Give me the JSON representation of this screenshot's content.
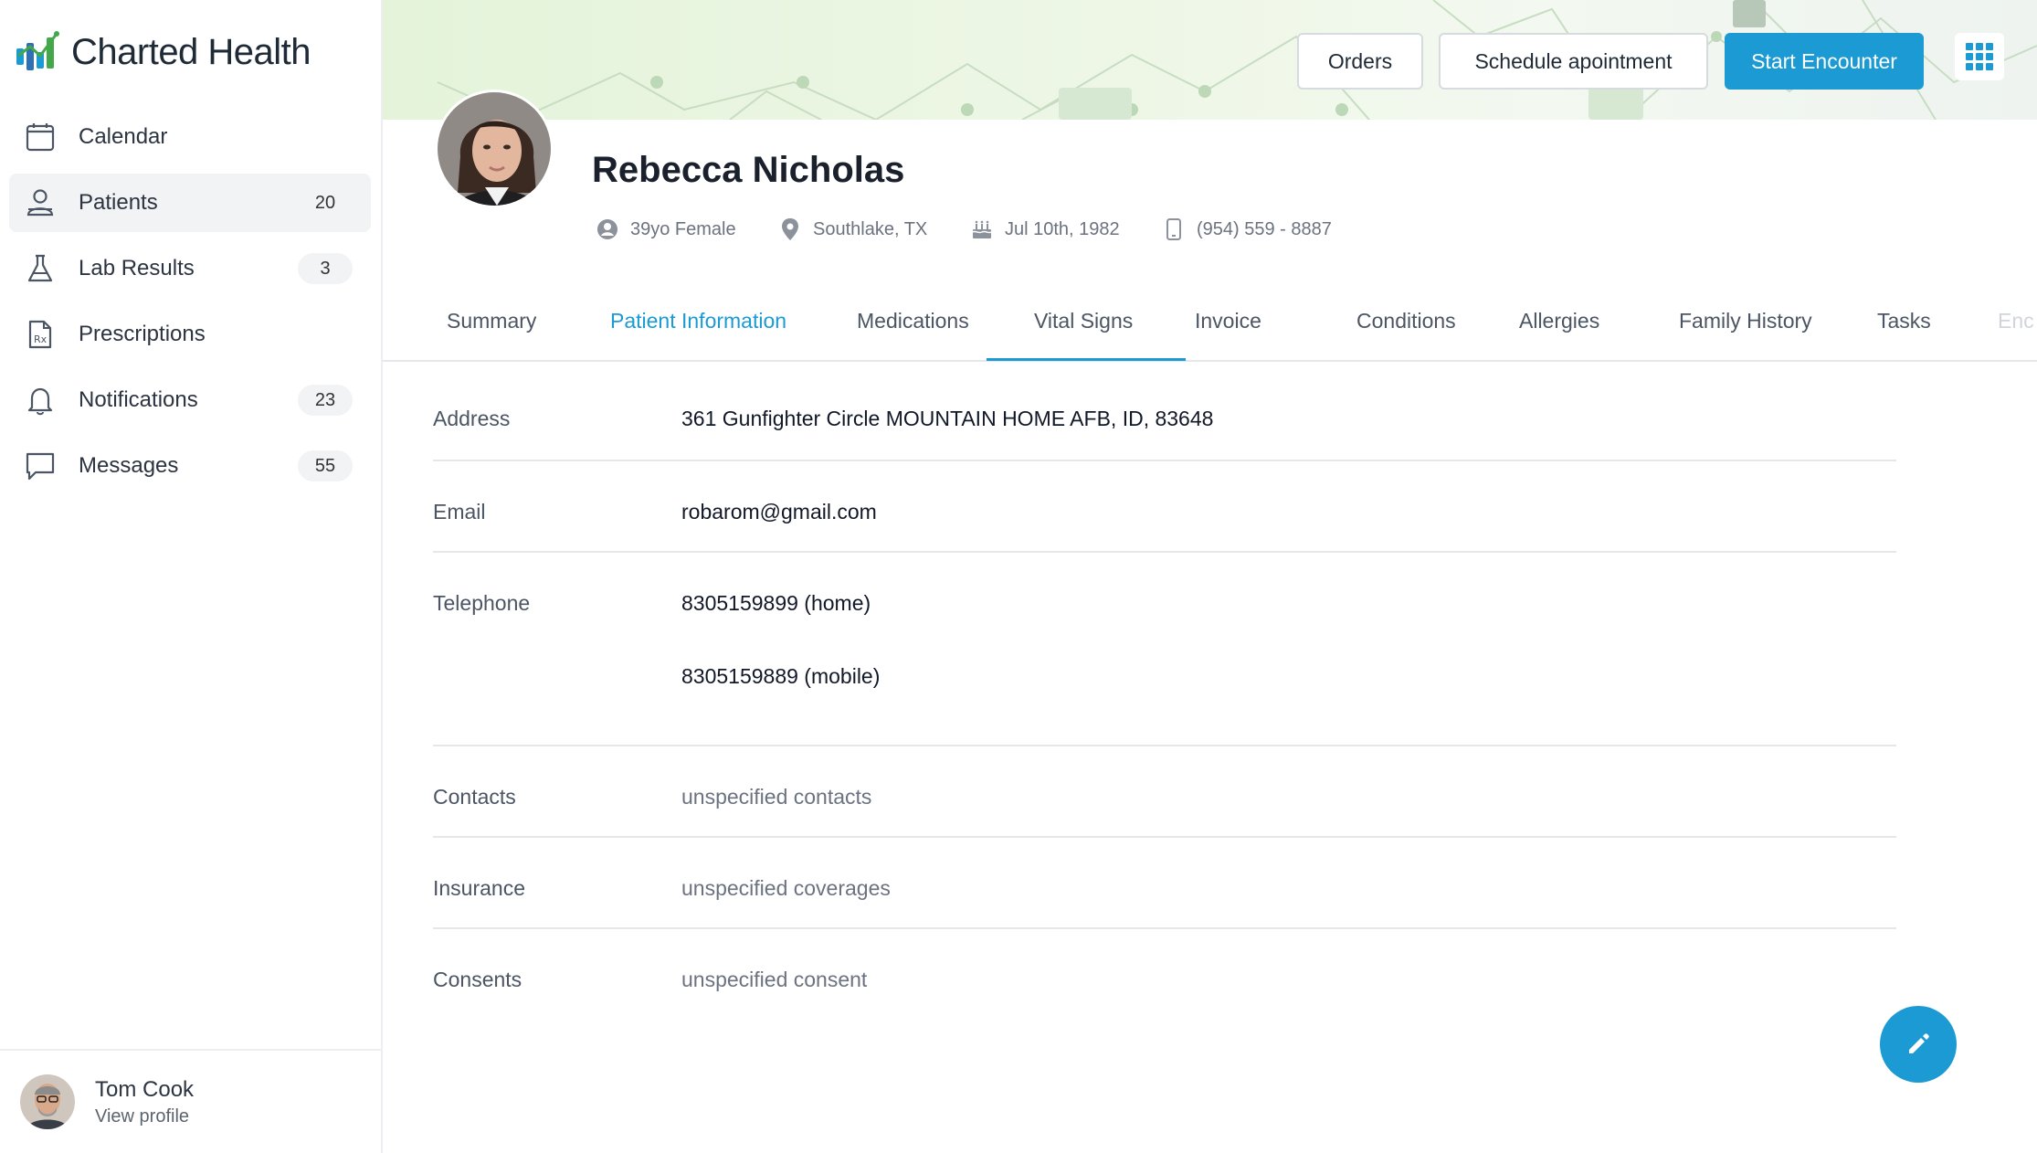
{
  "brand": {
    "name": "Charted Health",
    "accent": "#1b9ad3"
  },
  "sidebar": {
    "items": [
      {
        "label": "Calendar",
        "count": "",
        "icon": "calendar-icon",
        "active": false
      },
      {
        "label": "Patients",
        "count": "20",
        "icon": "patients-icon",
        "active": true
      },
      {
        "label": "Lab Results",
        "count": "3",
        "icon": "flask-icon",
        "active": false
      },
      {
        "label": "Prescriptions",
        "count": "",
        "icon": "prescription-icon",
        "active": false
      },
      {
        "label": "Notifications",
        "count": "23",
        "icon": "bell-icon",
        "active": false
      },
      {
        "label": "Messages",
        "count": "55",
        "icon": "message-icon",
        "active": false
      }
    ]
  },
  "user": {
    "name": "Tom Cook",
    "link": "View profile"
  },
  "header": {
    "orders_label": "Orders",
    "schedule_label": "Schedule apointment",
    "start_label": "Start Encounter"
  },
  "patient": {
    "name": "Rebecca Nicholas",
    "age_sex": "39yo Female",
    "location": "Southlake, TX",
    "dob": "Jul 10th, 1982",
    "phone": "(954) 559 - 8887"
  },
  "tabs": [
    {
      "label": "Summary",
      "active": false
    },
    {
      "label": "Patient Information",
      "active": true
    },
    {
      "label": "Medications",
      "active": false
    },
    {
      "label": "Vital Signs",
      "active": false
    },
    {
      "label": "Invoice",
      "active": false
    },
    {
      "label": "Conditions",
      "active": false
    },
    {
      "label": "Allergies",
      "active": false
    },
    {
      "label": "Family History",
      "active": false
    },
    {
      "label": "Tasks",
      "active": false
    },
    {
      "label": "Enc",
      "active": false
    }
  ],
  "info": {
    "address": {
      "label": "Address",
      "value": "361 Gunfighter Circle MOUNTAIN HOME AFB, ID, 83648"
    },
    "email": {
      "label": "Email",
      "value": "robarom@gmail.com"
    },
    "telephone": {
      "label": "Telephone",
      "home": "8305159899 (home)",
      "mobile": "8305159889 (mobile)"
    },
    "contacts": {
      "label": "Contacts",
      "value": "unspecified contacts"
    },
    "insurance": {
      "label": "Insurance",
      "value": "unspecified coverages"
    },
    "consents": {
      "label": "Consents",
      "value": "unspecified consent"
    }
  }
}
